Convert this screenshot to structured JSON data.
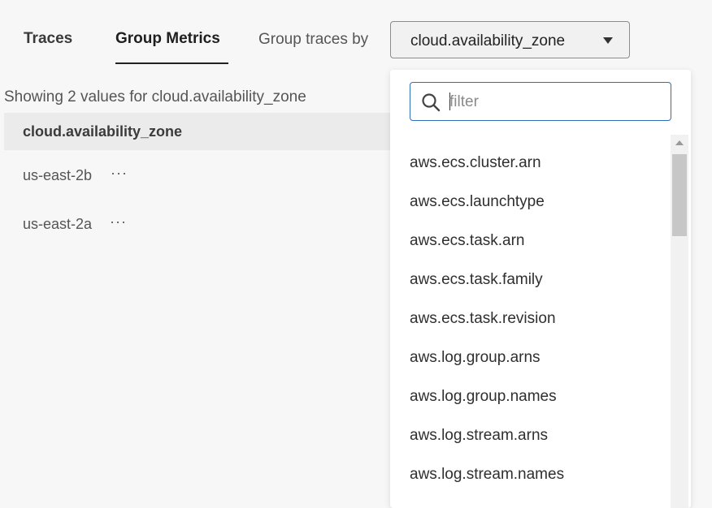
{
  "tabs": {
    "traces": "Traces",
    "group_metrics": "Group Metrics"
  },
  "group_by": {
    "label": "Group traces by",
    "selected": "cloud.availability_zone"
  },
  "summary": "Showing 2 values for cloud.availability_zone",
  "table": {
    "column_header": "cloud.availability_zone",
    "rows": [
      {
        "value": "us-east-2b",
        "more": "···"
      },
      {
        "value": "us-east-2a",
        "more": "···"
      }
    ]
  },
  "dropdown": {
    "filter_placeholder": "filter",
    "options": [
      "aws.ecs.cluster.arn",
      "aws.ecs.launchtype",
      "aws.ecs.task.arn",
      "aws.ecs.task.family",
      "aws.ecs.task.revision",
      "aws.log.group.arns",
      "aws.log.group.names",
      "aws.log.stream.arns",
      "aws.log.stream.names"
    ]
  },
  "colors": {
    "accent": "#2f6fb5",
    "background": "#f7f7f7"
  }
}
